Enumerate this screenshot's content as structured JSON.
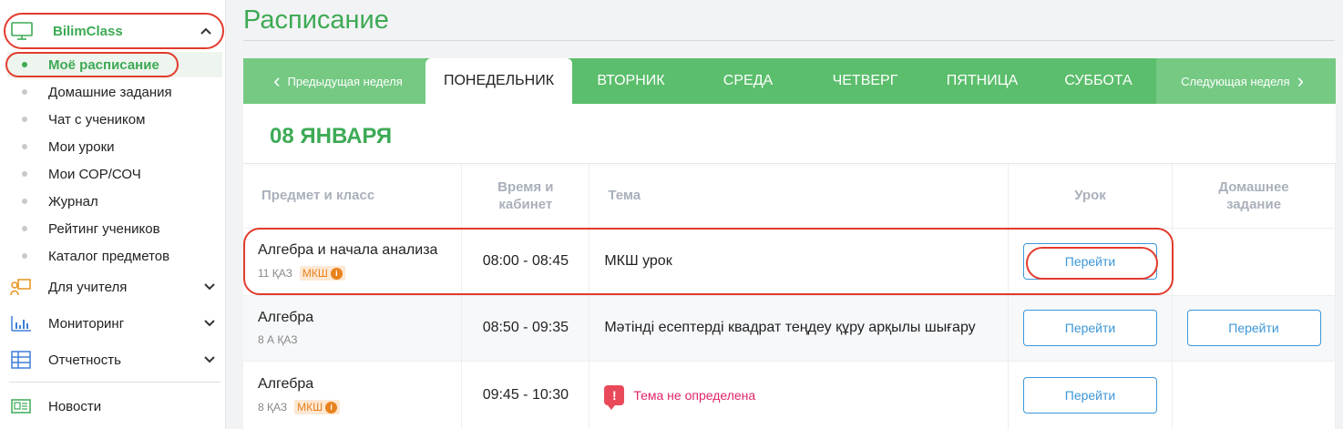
{
  "sidebar": {
    "app": {
      "label": "BilimClass"
    },
    "sub_items": [
      {
        "label": "Моё расписание"
      },
      {
        "label": "Домашние задания"
      },
      {
        "label": "Чат с учеником"
      },
      {
        "label": "Мои уроки"
      },
      {
        "label": "Мои СОР/СОЧ"
      },
      {
        "label": "Журнал"
      },
      {
        "label": "Рейтинг учеников"
      },
      {
        "label": "Каталог предметов"
      }
    ],
    "groups": [
      {
        "label": "Для учителя",
        "icon": "teacher-icon"
      },
      {
        "label": "Мониторинг",
        "icon": "bar-chart-icon"
      },
      {
        "label": "Отчетность",
        "icon": "table-icon"
      },
      {
        "label": "Новости",
        "icon": "news-icon"
      }
    ]
  },
  "page": {
    "title": "Расписание"
  },
  "tabs": {
    "prev": "Предыдущая неделя",
    "days": [
      "ПОНЕДЕЛЬНИК",
      "ВТОРНИК",
      "СРЕДА",
      "ЧЕТВЕРГ",
      "ПЯТНИЦА",
      "СУББОТА"
    ],
    "next": "Следующая неделя"
  },
  "date": "08 ЯНВАРЯ",
  "table": {
    "headers": [
      "Предмет и класс",
      "Время и кабинет",
      "Тема",
      "Урок",
      "Домашнее задание"
    ],
    "rows": [
      {
        "subject": "Алгебра и начала анализа",
        "class": "11 ҚАЗ",
        "badge": "МКШ",
        "time": "08:00 - 08:45",
        "topic": "МКШ урок",
        "lesson_btn": "Перейти"
      },
      {
        "subject": "Алгебра",
        "class": "8 А ҚАЗ",
        "time": "08:50 - 09:35",
        "topic": "Мәтінді есептерді квадрат теңдеу құру арқылы шығару",
        "lesson_btn": "Перейти",
        "hw_btn": "Перейти"
      },
      {
        "subject": "Алгебра",
        "class": "8 ҚАЗ",
        "badge": "МКШ",
        "time": "09:45 - 10:30",
        "topic": "Тема не определена",
        "lesson_btn": "Перейти"
      }
    ]
  },
  "colors": {
    "brand_green": "#3daa55",
    "tab_green": "#5bbe6c",
    "link_blue": "#3d97d8",
    "annotation_red": "#e23b2d",
    "error_pink": "#e0256a"
  }
}
